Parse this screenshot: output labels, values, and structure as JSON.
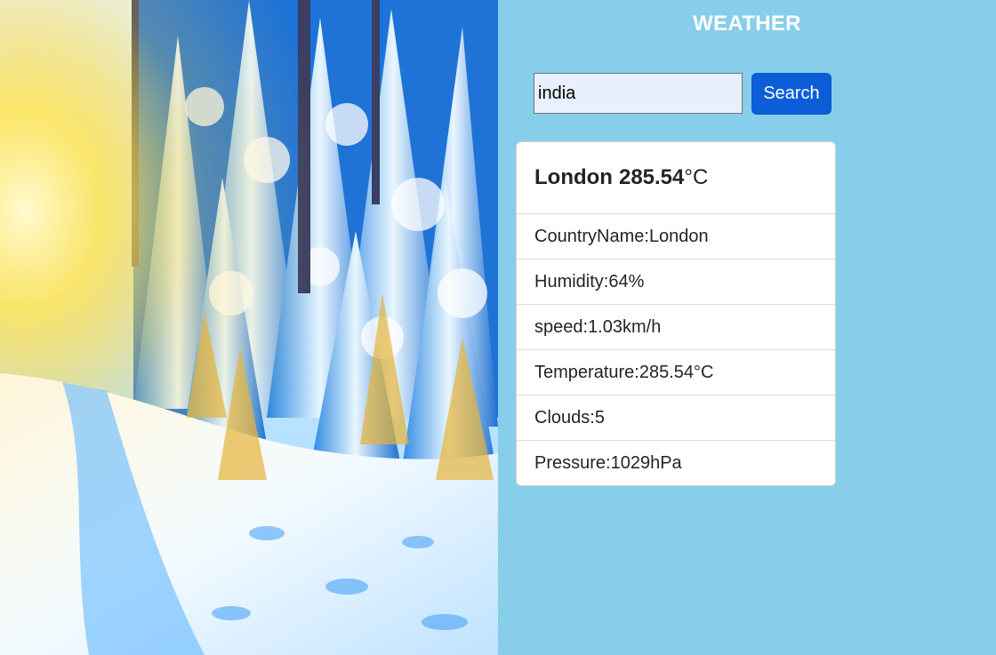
{
  "header": {
    "title": "WEATHER"
  },
  "search": {
    "value": "india",
    "button_label": "Search"
  },
  "card": {
    "city": "London",
    "temperature": "285.54",
    "unit": "°C",
    "rows": [
      {
        "label": "CountryName:",
        "value": "London"
      },
      {
        "label": "Humidity:",
        "value": "64%"
      },
      {
        "label": "speed:",
        "value": "1.03km/h"
      },
      {
        "label": "Temperature:",
        "value": "285.54°C"
      },
      {
        "label": "Clouds:",
        "value": "5"
      },
      {
        "label": "Pressure:",
        "value": "1029hPa"
      }
    ]
  },
  "colors": {
    "panel_background": "#87ceeb",
    "button_background": "#0b5ed7",
    "input_background": "#e8f0fe"
  }
}
